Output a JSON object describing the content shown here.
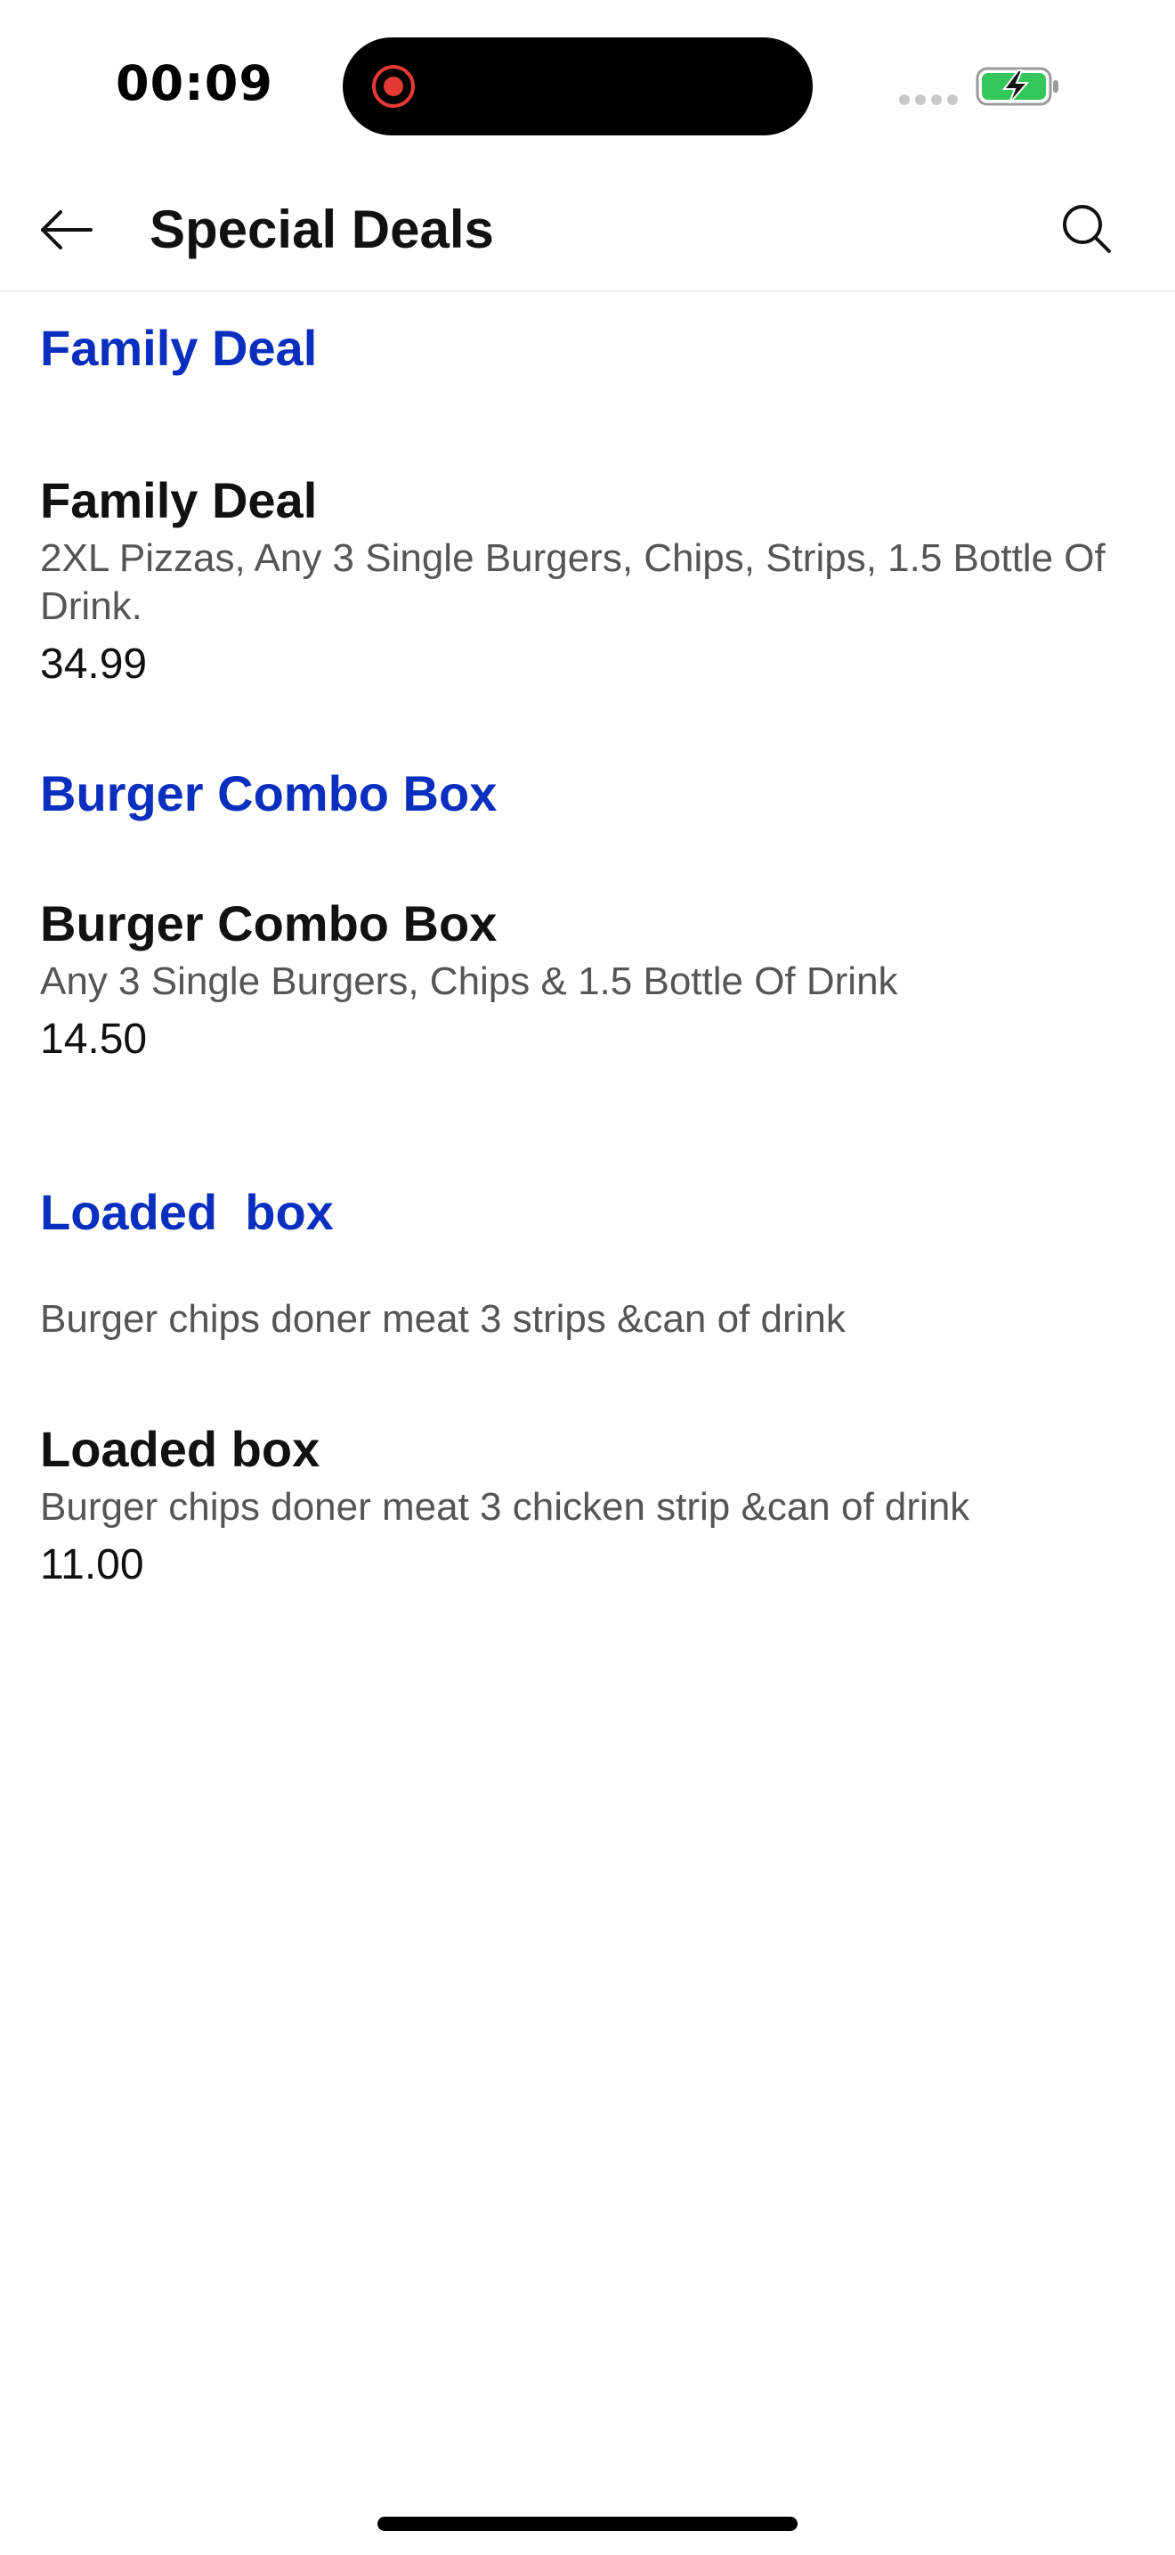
{
  "status_bar": {
    "time": "00:09",
    "icons": [
      "screen-recording-icon",
      "signal-icon",
      "battery-charging-icon"
    ],
    "colors": {
      "recording": "#e53935",
      "battery_fill": "#34c759"
    }
  },
  "header": {
    "title": "Special Deals",
    "icons": [
      "back-arrow-icon",
      "search-icon"
    ]
  },
  "sections": [
    {
      "title": "Family Deal",
      "description": "",
      "items": [
        {
          "name": "Family Deal",
          "description": "2XL Pizzas, Any 3 Single Burgers, Chips, Strips, 1.5 Bottle Of Drink.",
          "price": "34.99"
        }
      ]
    },
    {
      "title": "Burger Combo Box",
      "description": "",
      "items": [
        {
          "name": "Burger Combo Box",
          "description": "Any 3 Single Burgers, Chips & 1.5 Bottle Of Drink",
          "price": "14.50"
        }
      ]
    },
    {
      "title": "Loaded  box",
      "description": "Burger chips doner meat 3 strips &can of drink",
      "items": [
        {
          "name": "Loaded box",
          "description": "Burger chips doner meat 3 chicken strip &can of drink",
          "price": "11.00"
        }
      ]
    }
  ],
  "theme": {
    "section_title_color": "#0a2fbf",
    "text_color": "#111111",
    "secondary_text_color": "#555555"
  }
}
